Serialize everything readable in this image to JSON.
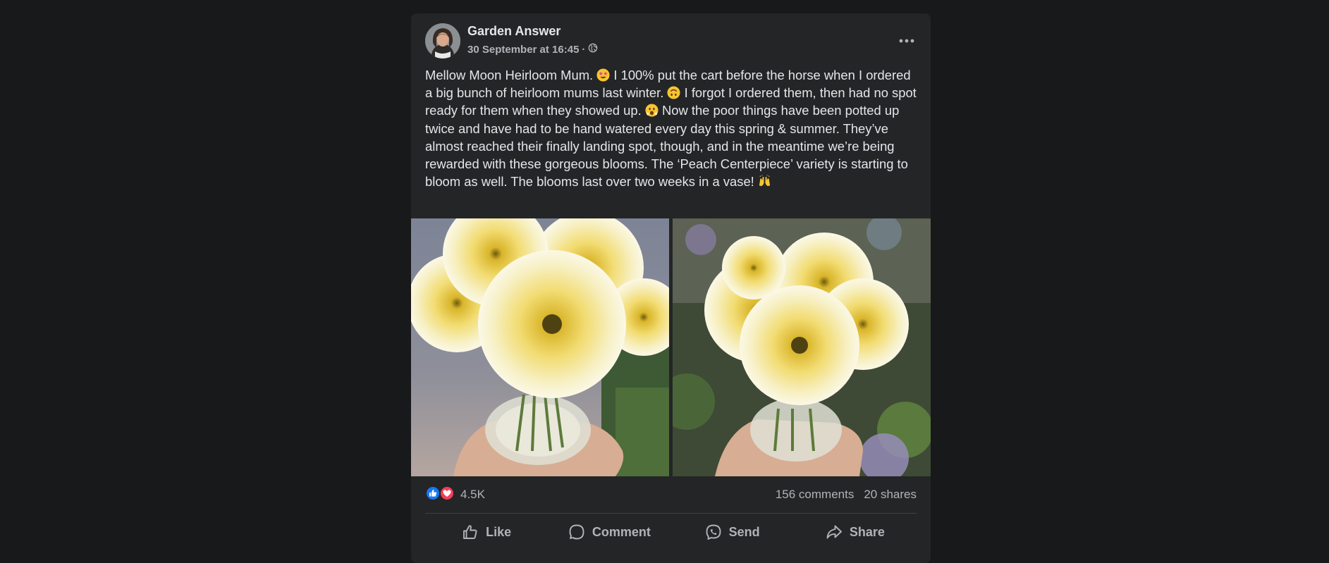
{
  "post": {
    "author": "Garden Answer",
    "timestamp": "30 September at 16:45",
    "separator": "·",
    "privacy_icon": "globe-icon",
    "more_icon": "more-options-icon",
    "text_segments": [
      "Mellow Moon Heirloom Mum.",
      "I 100% put the cart before the horse when I ordered a big bunch of heirloom mums last winter.",
      "I forgot I ordered them, then had no spot ready for them when they showed up.",
      "Now the poor things have been potted up twice and have had to be hand watered every day this spring & summer. They’ve almost reached their finally landing spot, though, and in the meantime we’re being rewarded with these gorgeous blooms. The ‘Peach Centerpiece’ variety is starting to bloom as well. The blooms last over two weeks in a vase!"
    ],
    "emojis": [
      "star-struck-emoji",
      "upside-down-face-emoji",
      "face-with-open-mouth-emoji",
      "raising-hands-emoji"
    ]
  },
  "stats": {
    "reaction_icons": [
      "like-reaction-icon",
      "love-reaction-icon"
    ],
    "reaction_count": "4.5K",
    "comments": "156 comments",
    "shares": "20 shares"
  },
  "actions": {
    "like": "Like",
    "comment": "Comment",
    "send": "Send",
    "share": "Share"
  },
  "colors": {
    "page_bg": "#18191a",
    "card_bg": "#242526",
    "primary_text": "#e4e6eb",
    "secondary_text": "#b0b3b8",
    "like_blue": "#1877f2",
    "love_red": "#f33e58"
  }
}
